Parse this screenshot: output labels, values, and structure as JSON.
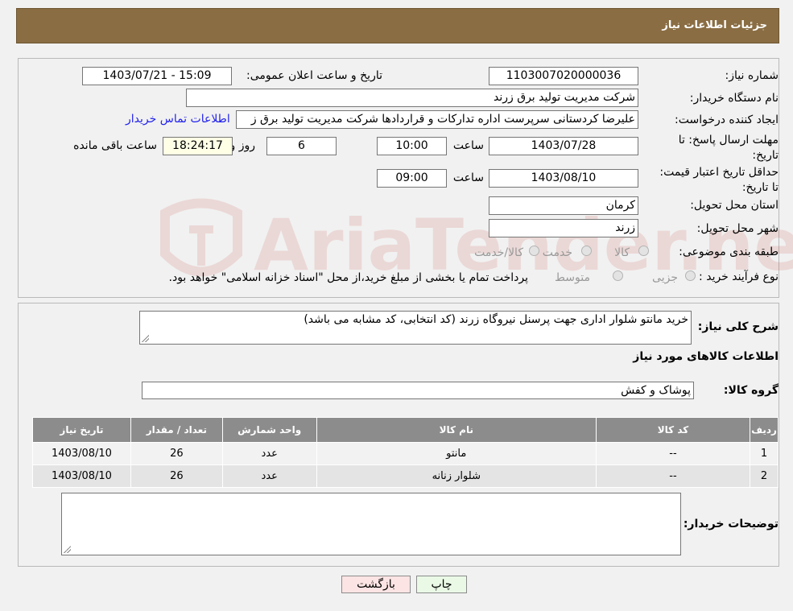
{
  "header": {
    "title": "جزئیات اطلاعات نیاز"
  },
  "fields": {
    "need_number_label": "شماره نیاز:",
    "need_number": "1103007020000036",
    "announce_label": "تاریخ و ساعت اعلان عمومی:",
    "announce_value": "1403/07/21 - 15:09",
    "buyer_org_label": "نام دستگاه خریدار:",
    "buyer_org": "شرکت مدیریت تولید برق زرند",
    "requester_label": "ایجاد کننده درخواست:",
    "requester": "علیرضا کردستانی سرپرست اداره تدارکات و قراردادها شرکت مدیریت تولید برق ز",
    "contact_link": "اطلاعات تماس خریدار",
    "deadline_label": "مهلت ارسال پاسخ: تا تاریخ:",
    "deadline_date": "1403/07/28",
    "time_label": "ساعت",
    "deadline_time": "10:00",
    "days_value": "6",
    "days_label": "روز و",
    "remaining_time": "18:24:17",
    "remaining_label": "ساعت باقی مانده",
    "validity_label": "حداقل تاریخ اعتبار قیمت: تا تاریخ:",
    "validity_date": "1403/08/10",
    "validity_time": "09:00",
    "province_label": "استان محل تحویل:",
    "province": "کرمان",
    "city_label": "شهر محل تحویل:",
    "city": "زرند",
    "category_label": "طبقه بندی موضوعی:",
    "category_options": [
      "کالا",
      "خدمت",
      "کالا/خدمت"
    ],
    "process_label": "نوع فرآیند خرید :",
    "process_options": [
      "جزیی",
      "متوسط"
    ],
    "process_note": "پرداخت تمام یا بخشی از مبلغ خرید،از محل \"اسناد خزانه اسلامی\" خواهد بود."
  },
  "description": {
    "label": "شرح کلی نیاز:",
    "value": "خرید مانتو شلوار اداری جهت پرسنل نیروگاه زرند (کد انتخابی، کد مشابه می باشد)"
  },
  "goods": {
    "section_title": "اطلاعات کالاهای مورد نیاز",
    "group_label": "گروه کالا:",
    "group_value": "پوشاک و کفش",
    "columns": [
      "ردیف",
      "کد کالا",
      "نام کالا",
      "واحد شمارش",
      "تعداد / مقدار",
      "تاریخ نیاز"
    ],
    "rows": [
      {
        "row": "1",
        "code": "--",
        "name": "مانتو",
        "unit": "عدد",
        "qty": "26",
        "date": "1403/08/10"
      },
      {
        "row": "2",
        "code": "--",
        "name": "شلوار زنانه",
        "unit": "عدد",
        "qty": "26",
        "date": "1403/08/10"
      }
    ]
  },
  "buyer_notes": {
    "label": "توضیحات خریدار:",
    "value": ""
  },
  "buttons": {
    "print": "چاپ",
    "back": "بازگشت"
  },
  "watermark": {
    "text": "AriaTender.neT"
  },
  "colors": {
    "header": "#8a6d43",
    "link": "#2222ee",
    "back_button": "#fde4e4",
    "print_button": "#eaf9e6"
  }
}
